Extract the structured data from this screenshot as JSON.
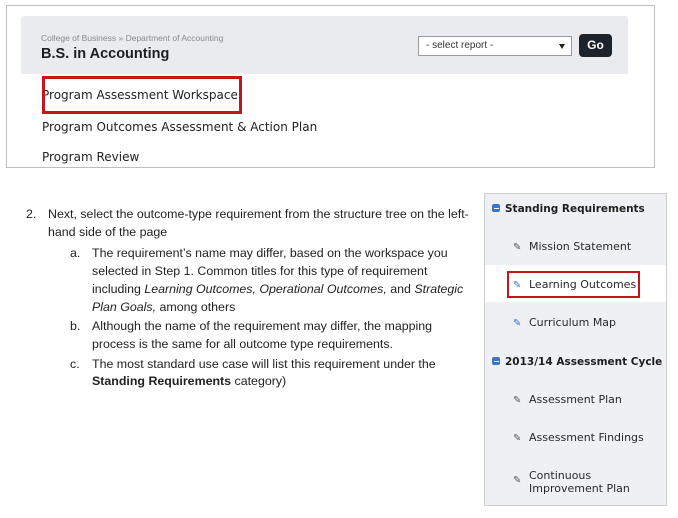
{
  "portal": {
    "breadcrumb": "College of Business » Department of Accounting",
    "program_title": "B.S. in Accounting",
    "report_select": {
      "value": "- select report -"
    },
    "go_label": "Go",
    "menu": [
      "Program Assessment Workspace",
      "Program Outcomes Assessment & Action Plan",
      "Program Review"
    ]
  },
  "instructions": {
    "step_number": "2.",
    "step_text": "Next, select the outcome-type requirement from the structure tree on the left-hand side of the page",
    "sub_items": [
      {
        "letter": "a.",
        "parts": [
          {
            "text": "The requirement’s name may differ, based on the workspace you selected in Step 1. Common titles for this type of requirement including ",
            "style": "normal"
          },
          {
            "text": "Learning Outcomes, Operational Outcomes,",
            "style": "italic"
          },
          {
            "text": " and ",
            "style": "normal"
          },
          {
            "text": "Strategic Plan Goals,",
            "style": "italic"
          },
          {
            "text": " among others",
            "style": "normal"
          }
        ]
      },
      {
        "letter": "b.",
        "parts": [
          {
            "text": "Although the name of the requirement may differ, the mapping process is the same for all outcome type requirements.",
            "style": "normal"
          }
        ]
      },
      {
        "letter": "c.",
        "parts": [
          {
            "text": "The most standard use case will list this requirement under the ",
            "style": "normal"
          },
          {
            "text": "Standing Requirements",
            "style": "bold"
          },
          {
            "text": " category)",
            "style": "normal"
          }
        ]
      }
    ]
  },
  "tree": {
    "categories": [
      {
        "label": "Standing Requirements",
        "items": [
          {
            "label": "Mission Statement",
            "icon": "warning-edit-icon"
          },
          {
            "label": "Learning Outcomes",
            "icon": "pencil-icon"
          },
          {
            "label": "Curriculum Map",
            "icon": "pencil-icon"
          }
        ]
      },
      {
        "label": "2013/14 Assessment Cycle",
        "items": [
          {
            "label": "Assessment Plan",
            "icon": "warning-edit-icon"
          },
          {
            "label": "Assessment Findings",
            "icon": "warning-edit-icon"
          },
          {
            "label": "Continuous Improvement Plan",
            "icon": "warning-edit-icon"
          }
        ]
      }
    ]
  },
  "colors": {
    "highlight": "#c4161c",
    "header_bg": "#e9ebee",
    "tree_bg": "#eef0f3",
    "go_button": "#1d232b",
    "accent_blue": "#3a73c8"
  }
}
